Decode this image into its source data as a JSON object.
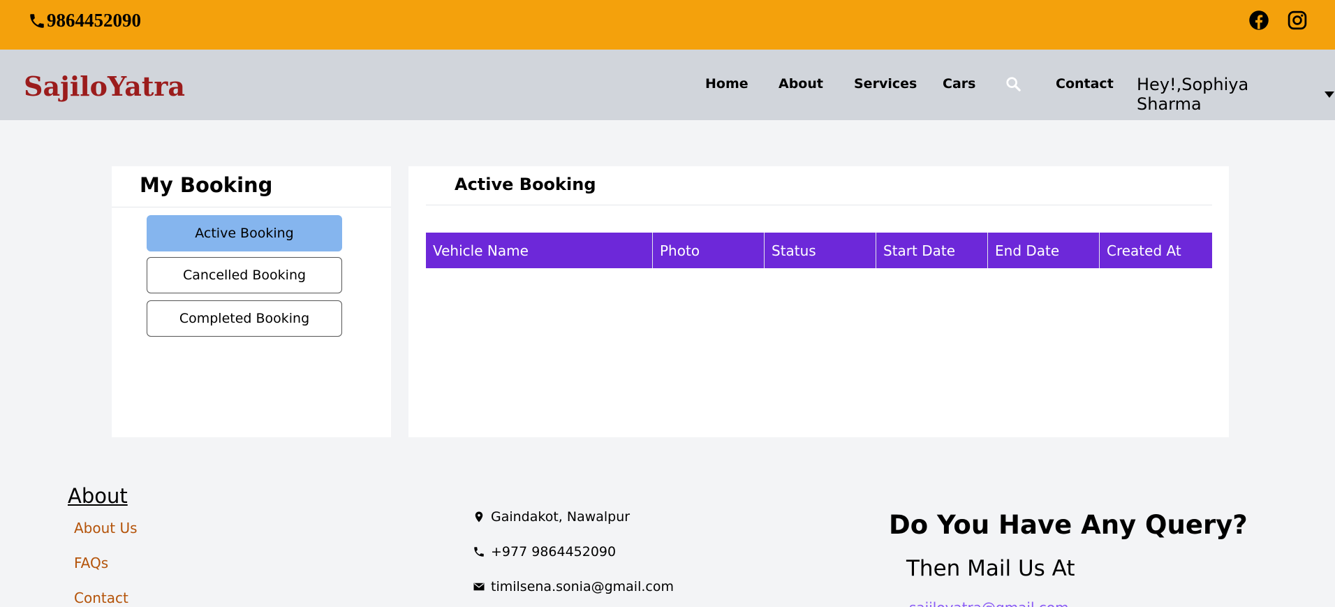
{
  "topbar": {
    "phone": "9864452090",
    "icons": [
      "phone-icon",
      "facebook-icon",
      "instagram-icon"
    ],
    "color": "#f4a10c"
  },
  "navbar": {
    "brand": "SajiloYatra",
    "links": [
      "Home",
      "About",
      "Services",
      "Cars",
      "Contact"
    ],
    "user_greeting": "Hey!,Sophiya Sharma",
    "brand_color": "#9b1c1c"
  },
  "sidebar": {
    "title": "My Booking",
    "buttons": [
      "Active Booking",
      "Cancelled Booking",
      "Completed Booking"
    ],
    "active_index": 0
  },
  "main": {
    "title": "Active Booking",
    "columns": [
      "Vehicle Name",
      "Photo",
      "Status",
      "Start Date",
      "End Date",
      "Created At"
    ],
    "rows": [],
    "header_color": "#6d28d9"
  },
  "footer": {
    "about_title": "About",
    "about_links": [
      "About Us",
      "FAQs",
      "Contact"
    ],
    "address": "Gaindakot, Nawalpur",
    "phone": "+977 9864452090",
    "email": "timilsena.sonia@gmail.com",
    "query_title": "Do You Have Any Query?",
    "query_sub": "Then Mail Us At",
    "query_email": "sajiloyatra@gmail.com"
  }
}
